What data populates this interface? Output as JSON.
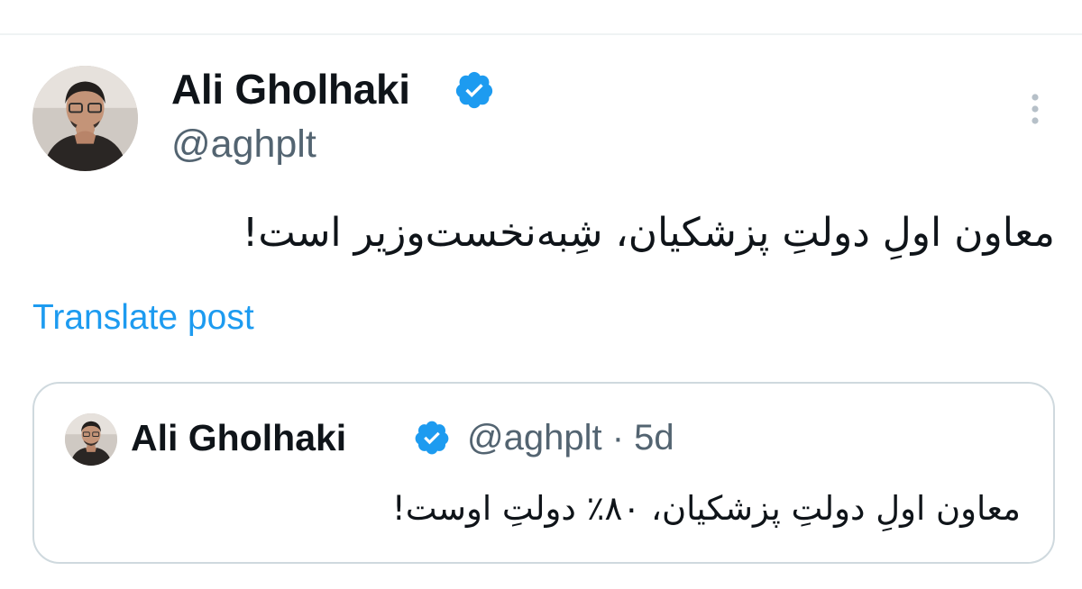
{
  "tweet": {
    "author": {
      "name": "Ali Gholhaki",
      "handle": "@aghplt",
      "verified": true,
      "avatar_icon": "avatar-photo"
    },
    "text": "معاون اولِ دولتِ پزشکیان، شِبه‌نخست‌وزیر است!",
    "translate_label": "Translate post",
    "more_icon": "more-vertical-icon"
  },
  "quoted_tweet": {
    "author": {
      "name": "Ali Gholhaki",
      "handle": "@aghplt",
      "verified": true
    },
    "separator": "·",
    "age": "5d",
    "meta": "@aghplt · 5d",
    "text": "معاون اولِ دولتِ پزشکیان، ۸۰٪ دولتِ اوست!"
  },
  "colors": {
    "verified_badge": "#1d9bf0",
    "link": "#1d9bf0",
    "secondary_text": "#536471",
    "border": "#cfd9de"
  }
}
